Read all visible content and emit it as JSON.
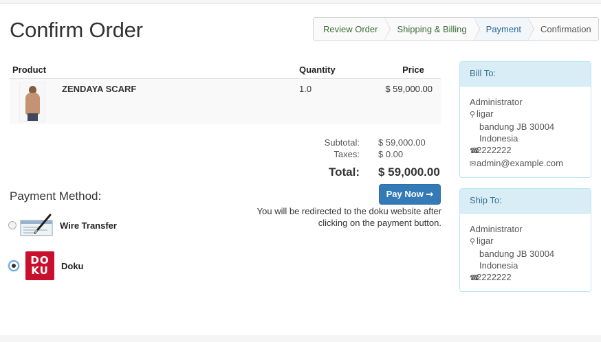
{
  "page": {
    "title": "Confirm Order"
  },
  "wizard": {
    "steps": [
      {
        "label": "Review Order",
        "state": "done"
      },
      {
        "label": "Shipping & Billing",
        "state": "done"
      },
      {
        "label": "Payment",
        "state": "active"
      },
      {
        "label": "Confirmation",
        "state": "future"
      }
    ]
  },
  "table": {
    "headers": {
      "product": "Product",
      "quantity": "Quantity",
      "price": "Price"
    },
    "rows": [
      {
        "name": "ZENDAYA SCARF",
        "quantity": "1.0",
        "price": "$ 59,000.00",
        "image_icon": "product-photo"
      }
    ]
  },
  "totals": {
    "subtotal_label": "Subtotal:",
    "subtotal_value": "$ 59,000.00",
    "taxes_label": "Taxes:",
    "taxes_value": "$ 0.00",
    "total_label": "Total:",
    "total_value": "$ 59,000.00"
  },
  "payment": {
    "title": "Payment Method:",
    "methods": [
      {
        "label": "Wire Transfer",
        "selected": false,
        "icon": "check-pen-icon"
      },
      {
        "label": "Doku",
        "selected": true,
        "icon": "doku-logo",
        "logo_text_top": "DO",
        "logo_text_bottom": "KU"
      }
    ],
    "button_label": "Pay Now ➞",
    "redirect_note": "You will be redirected to the doku website after clicking on the payment button."
  },
  "bill_to": {
    "heading": "Bill To:",
    "name": "Administrator",
    "street": "ligar",
    "city_line": "bandung JB 30004",
    "country": "Indonesia",
    "phone": "2222222",
    "email": "admin@example.com"
  },
  "ship_to": {
    "heading": "Ship To:",
    "name": "Administrator",
    "street": "ligar",
    "city_line": "bandung JB 30004",
    "country": "Indonesia",
    "phone": "2222222"
  },
  "colors": {
    "primary_button": "#337ab7",
    "panel_heading_bg": "#d9edf7",
    "panel_heading_text": "#31708f",
    "wizard_done_text": "#3a6e35",
    "wizard_active_text": "#2a6496",
    "doku_red": "#c8102e"
  }
}
